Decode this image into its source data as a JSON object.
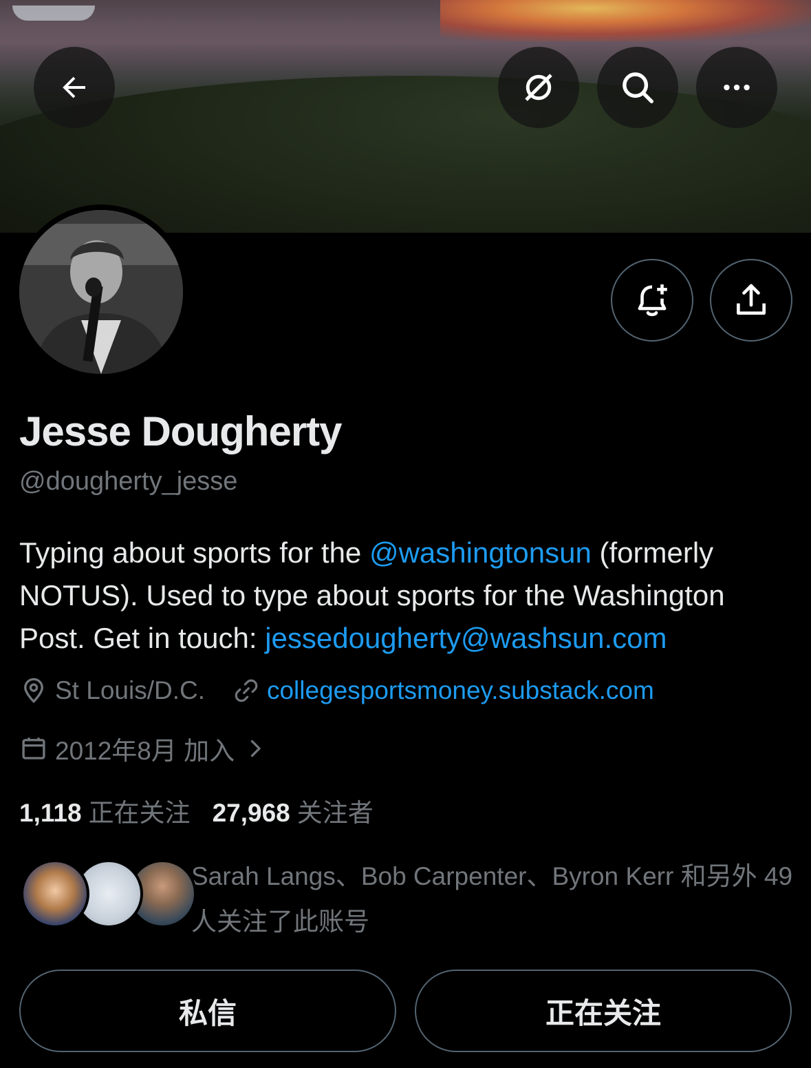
{
  "header": {
    "back_icon": "arrow-left-icon",
    "grok_icon": "grok-icon",
    "search_icon": "search-icon",
    "more_icon": "more-icon"
  },
  "profile": {
    "name": "Jesse Dougherty",
    "handle": "@dougherty_jesse",
    "bio": {
      "part1": "Typing about sports for the ",
      "mention": "@washingtonsun",
      "part2": " (formerly NOTUS). Used to type about sports for the Washington Post. Get in touch: ",
      "email": "jessedougherty@washsun.com"
    },
    "location": "St Louis/D.C.",
    "website": "collegesportsmoney.substack.com",
    "joined": "2012年8月 加入",
    "following_count": "1,118",
    "following_label": "正在关注",
    "followers_count": "27,968",
    "followers_label": "关注者",
    "known_followers": "Sarah Langs、Bob Carpenter、Byron Kerr 和另外 49 人关注了此账号"
  },
  "actions": {
    "message": "私信",
    "following": "正在关注"
  },
  "colors": {
    "background": "#000000",
    "accent": "#1d9bf0",
    "secondary_text": "#71767b",
    "border": "#536471"
  }
}
